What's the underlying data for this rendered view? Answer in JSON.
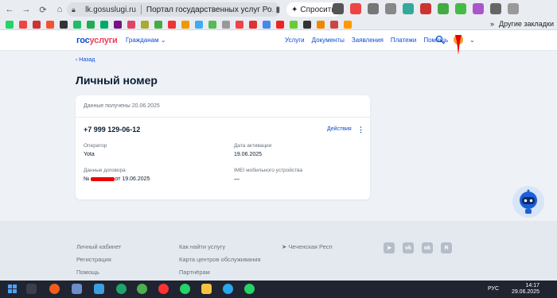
{
  "browser": {
    "url": "lk.gosuslugi.ru",
    "page_title": "Портал государственных услуг Ро...",
    "ask_label": "Спросить",
    "other_bookmarks": "Другие закладки"
  },
  "header": {
    "logo_part1": "гос",
    "logo_part2": "услуги",
    "citizens_label": "Гражданам",
    "nav": [
      "Услуги",
      "Документы",
      "Заявления",
      "Платежи",
      "Помощь"
    ]
  },
  "main": {
    "back_label": "Назад",
    "title": "Личный номер",
    "card": {
      "received": "Данные получены 20.06.2025",
      "phone": "+7 999 129-06-12",
      "actions_label": "Действия",
      "operator_label": "Оператор",
      "operator_value": "Yota",
      "activation_label": "Дата активации",
      "activation_value": "19.06.2025",
      "contract_label": "Данные договора",
      "contract_prefix": "№",
      "contract_suffix": "от 19.06.2025",
      "imei_label": "IMEI мобильного устройства",
      "imei_value": "—"
    }
  },
  "footer": {
    "col1": [
      "Личный кабинет",
      "Регистрация",
      "Помощь"
    ],
    "col2": [
      "Как найти услугу",
      "Карта центров обслуживания",
      "Партнёрам"
    ],
    "region": "Чеченская Респ"
  },
  "taskbar": {
    "lang": "РУС",
    "time": "14:17",
    "date": "29.06.2025"
  },
  "colors": {
    "brand_blue": "#0d4cd3",
    "brand_red": "#ee3f58",
    "page_bg": "#eef2f7"
  }
}
